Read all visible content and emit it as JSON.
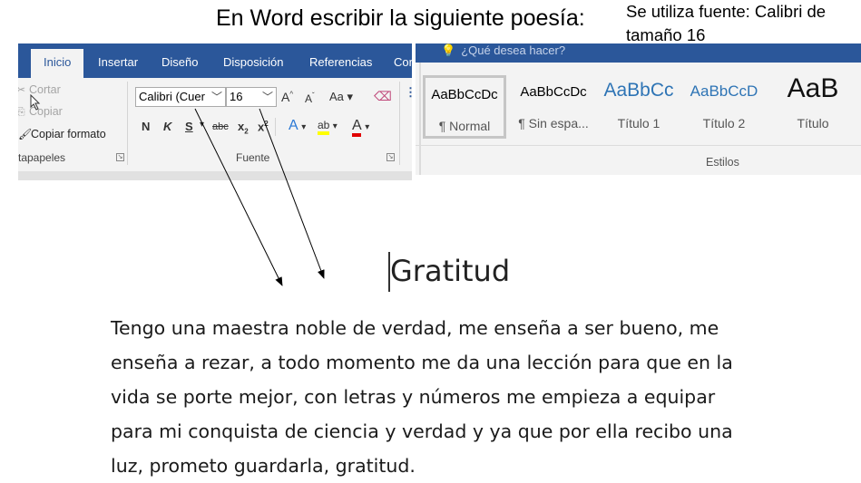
{
  "instruction": "En Word escribir la siguiente poesía:",
  "note": {
    "line1": "Se utiliza  fuente: Calibri de",
    "line2": "tamaño 16"
  },
  "ribbon_tabs": [
    {
      "label": "Inicio",
      "active": true
    },
    {
      "label": "Insertar"
    },
    {
      "label": "Diseño"
    },
    {
      "label": "Disposición"
    },
    {
      "label": "Referencias"
    },
    {
      "label": "Cor"
    }
  ],
  "clipboard": {
    "cut": "Cortar",
    "copy": "Copiar",
    "format_painter": "Copiar formato",
    "group_label": "rtapapeles"
  },
  "font": {
    "name": "Calibri (Cuer",
    "size": "16",
    "grow": "A",
    "shrink": "A",
    "case": "Aa",
    "bold": "N",
    "italic": "K",
    "underline": "S",
    "strike": "abc",
    "subscript": "x",
    "superscript": "x",
    "effects": "A",
    "highlight": "ab",
    "color": "A",
    "group_label": "Fuente"
  },
  "tell_me": "¿Qué desea hacer?",
  "styles": {
    "items": [
      {
        "sample": "AaBbCcDc",
        "name": "¶ Normal",
        "selected": true
      },
      {
        "sample": "AaBbCcDc",
        "name": "¶ Sin espa..."
      },
      {
        "sample": "AaBbCc",
        "name": "Título 1"
      },
      {
        "sample": "AaBbCcD",
        "name": "Título 2"
      },
      {
        "sample": "AaB",
        "name": "Título"
      }
    ],
    "group_label": "Estilos"
  },
  "colors": {
    "ribbon_blue": "#2b579a",
    "ribbon_bg": "#f3f3f3",
    "heading_blue": "#2e74b5",
    "highlight_yellow": "#ffff00",
    "font_red": "#e00000"
  },
  "document": {
    "title": "Gratitud",
    "poem": [
      "Tengo una maestra noble de verdad, me enseña a ser bueno, me",
      "enseña a rezar, a todo momento me da una lección para que en la",
      "vida se porte mejor, con letras y números me empieza a equipar",
      "para mi conquista de ciencia y verdad y ya que por ella recibo una",
      "luz, prometo guardarla, gratitud."
    ]
  }
}
